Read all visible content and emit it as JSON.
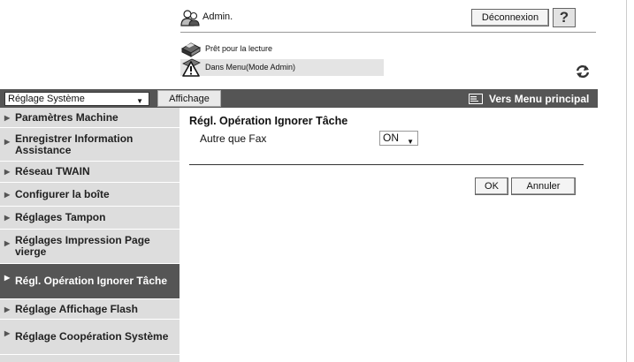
{
  "header": {
    "admin_label": "Admin.",
    "logout_label": "Déconnexion",
    "help_label": "?",
    "status_ready": "Prêt pour la lecture",
    "status_menu": "Dans Menu(Mode Admin)"
  },
  "menubar": {
    "system_select": "Réglage Système",
    "display_tab": "Affichage",
    "main_menu_link": "Vers Menu principal"
  },
  "sidebar": {
    "items": [
      {
        "label": "Paramètres Machine"
      },
      {
        "label": "Enregistrer Information Assistance"
      },
      {
        "label": "Réseau TWAIN"
      },
      {
        "label": "Configurer la boîte"
      },
      {
        "label": "Réglages Tampon"
      },
      {
        "label": "Réglages Impression Page vierge"
      },
      {
        "label": "Régl. Opération Ignorer Tâche"
      },
      {
        "label": "Réglage Affichage Flash"
      },
      {
        "label": "Réglage Coopération Système"
      }
    ]
  },
  "content": {
    "title": "Régl. Opération Ignorer Tâche",
    "field_label": "Autre que Fax",
    "field_value": "ON",
    "ok_label": "OK",
    "cancel_label": "Annuler"
  },
  "colors": {
    "menubar_bg": "#555555",
    "sidebar_bg": "#dddddd",
    "sidebar_active_bg": "#555555"
  }
}
